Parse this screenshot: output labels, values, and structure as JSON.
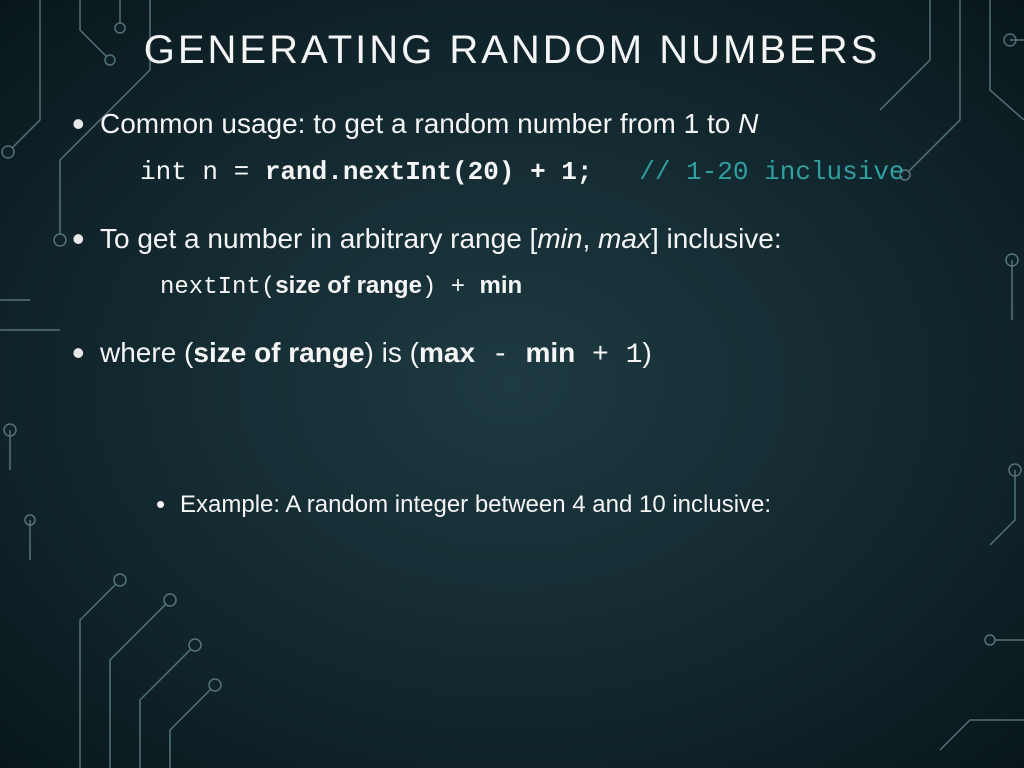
{
  "title": "GENERATING RANDOM NUMBERS",
  "bullets": {
    "b1_pre": "Common usage: to get a random number from 1 to ",
    "b1_ital": "N",
    "code1_plain": "int n = ",
    "code1_bold": "rand.nextInt(20) + 1;",
    "code1_comment": "   // 1-20 inclusive",
    "b2_pre": "To get a number in arbitrary range [",
    "b2_min": "min",
    "b2_comma": ", ",
    "b2_max": "max",
    "b2_post": "] inclusive:",
    "code2_a": "nextInt(",
    "code2_b": "size of range",
    "code2_c": ")  +  ",
    "code2_d": "min",
    "b3_pre": "where (",
    "b3_sor": "size of range",
    "b3_mid": ") is (",
    "b3_max": "max",
    "b3_minus": "  -  ",
    "b3_min": "min",
    "b3_plus": "  +  1",
    "b3_post": ")",
    "example": "Example: A random integer between 4 and 10 inclusive:"
  }
}
